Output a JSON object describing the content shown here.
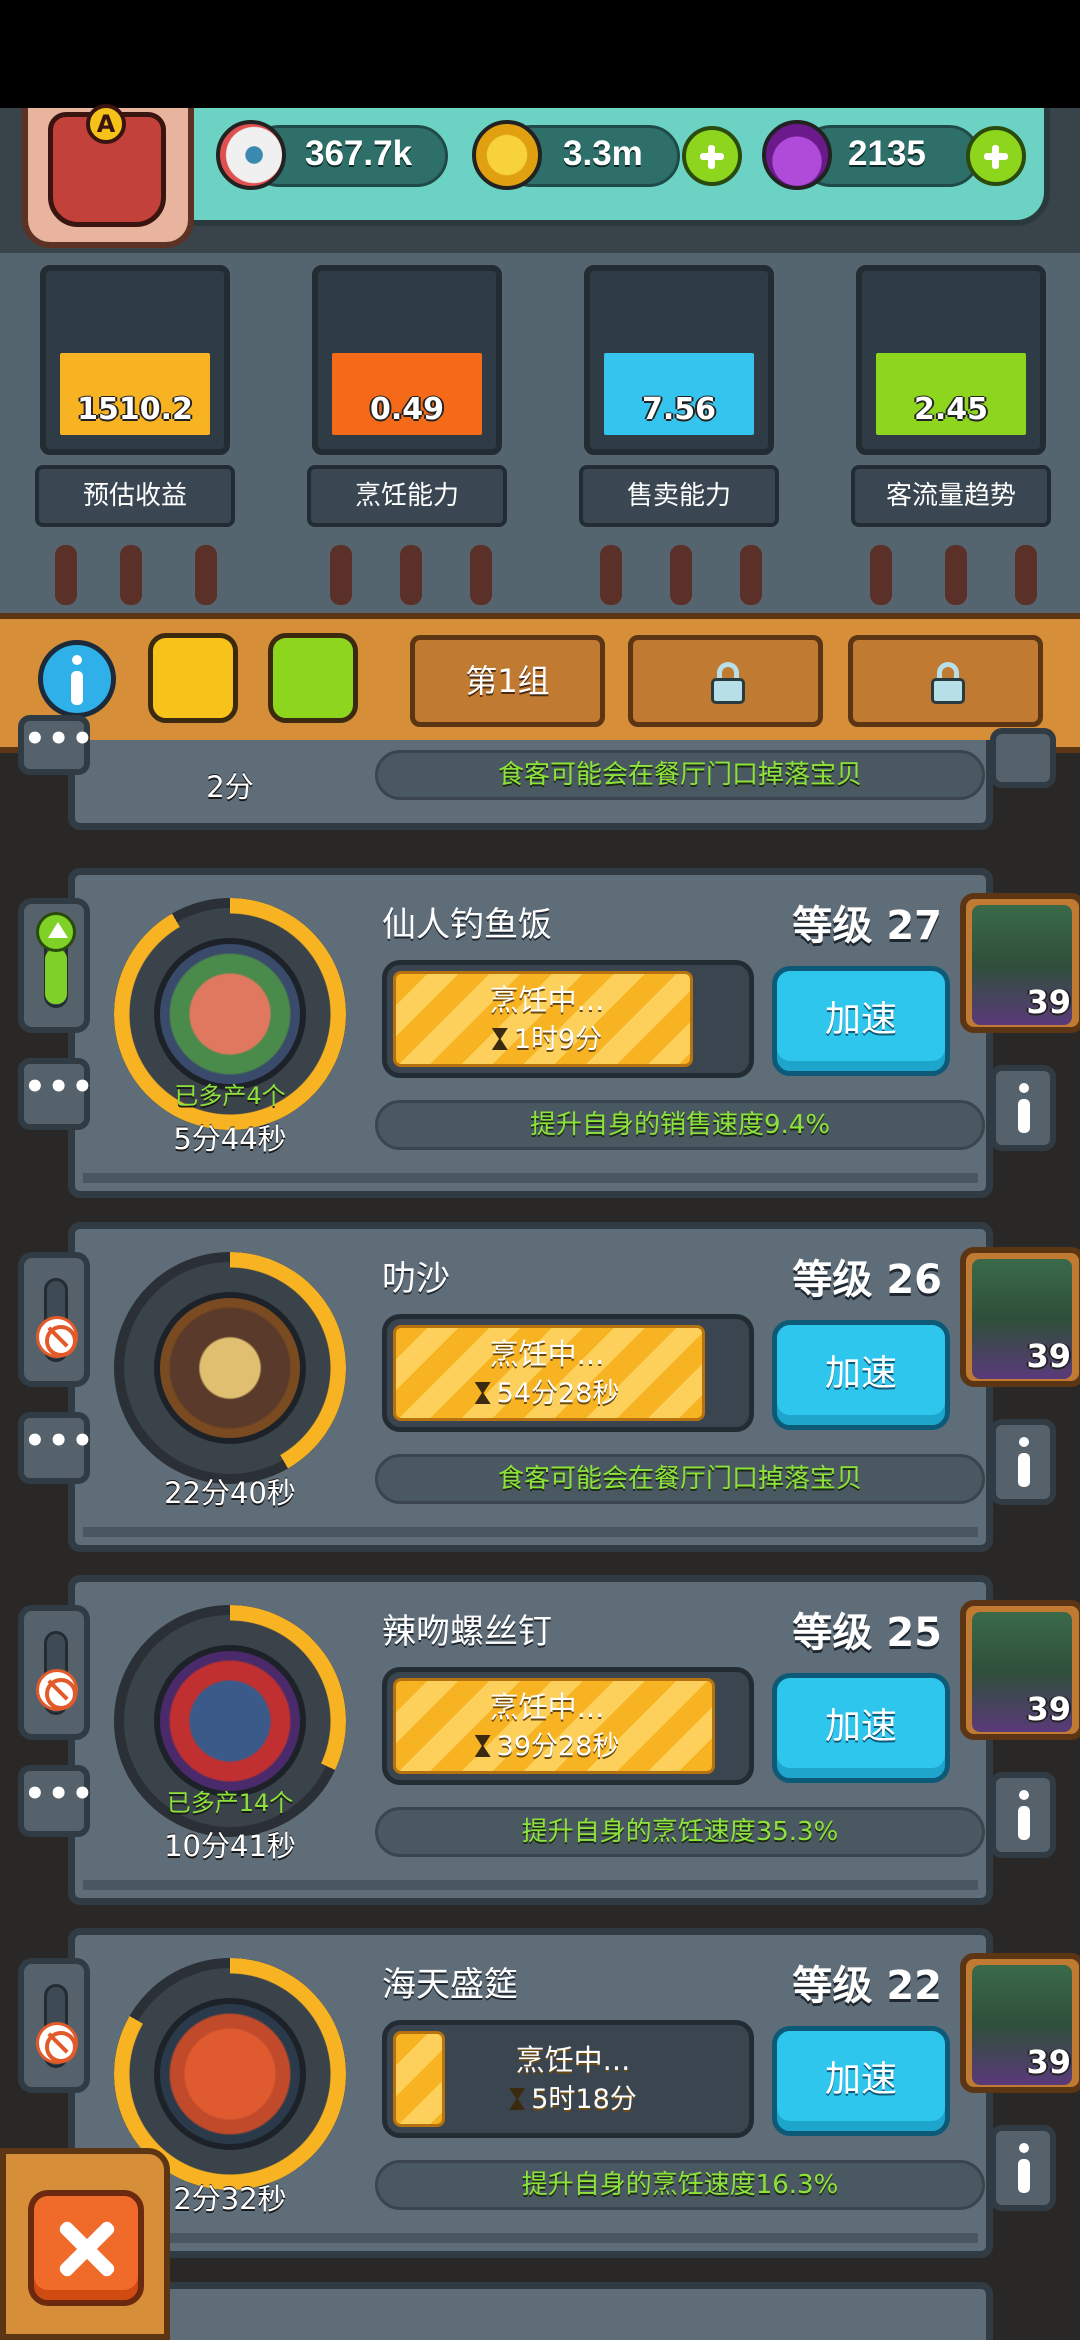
{
  "resources": {
    "eyeballs": "367.7k",
    "coins": "3.3m",
    "potions": "2135",
    "eyeball_icon": "eyeball-icon",
    "coin_icon": "coin-icon",
    "potion_icon": "potion-icon"
  },
  "avatar": {
    "badge": "A"
  },
  "stats": [
    {
      "value": "1510.2",
      "label": "预估收益",
      "color": "#f7b321"
    },
    {
      "value": "0.49",
      "label": "烹饪能力",
      "color": "#f56a18"
    },
    {
      "value": "7.56",
      "label": "售卖能力",
      "color": "#35c4ee"
    },
    {
      "value": "2.45",
      "label": "客流量趋势",
      "color": "#8ed51d"
    }
  ],
  "toolbar": {
    "group_tab": "第1组",
    "icons": [
      "info-icon",
      "shirt-icon",
      "sushi-icon",
      "lock-icon",
      "lock-icon"
    ]
  },
  "partial_card": {
    "time": "2分",
    "bonus": "食客可能会在餐厅门口掉落宝贝"
  },
  "recipes": [
    {
      "name": "仙人钓鱼饭",
      "level": "等级 27",
      "status": "烹饪中...",
      "cook_time": "1时9分",
      "progress": 0.82,
      "extra": "已多产4个",
      "time": "5分44秒",
      "speed": "加速",
      "bonus": "提升自身的销售速度9.4%",
      "chef_count": "39",
      "toggle": "up"
    },
    {
      "name": "叻沙",
      "level": "等级 26",
      "status": "烹饪中...",
      "cook_time": "54分28秒",
      "progress": 0.85,
      "extra": "",
      "time": "22分40秒",
      "speed": "加速",
      "bonus": "食客可能会在餐厅门口掉落宝贝",
      "chef_count": "39",
      "toggle": "stop"
    },
    {
      "name": "辣吻螺丝钉",
      "level": "等级 25",
      "status": "烹饪中...",
      "cook_time": "39分28秒",
      "progress": 0.87,
      "extra": "已多产14个",
      "time": "10分41秒",
      "speed": "加速",
      "bonus": "提升自身的烹饪速度35.3%",
      "chef_count": "39",
      "toggle": "stop"
    },
    {
      "name": "海天盛筵",
      "level": "等级 22",
      "status": "烹饪中...",
      "cook_time": "5时18分",
      "progress": 0.1,
      "extra": "",
      "time": "2分32秒",
      "speed": "加速",
      "bonus": "提升自身的烹饪速度16.3%",
      "chef_count": "39",
      "toggle": "stop"
    }
  ]
}
